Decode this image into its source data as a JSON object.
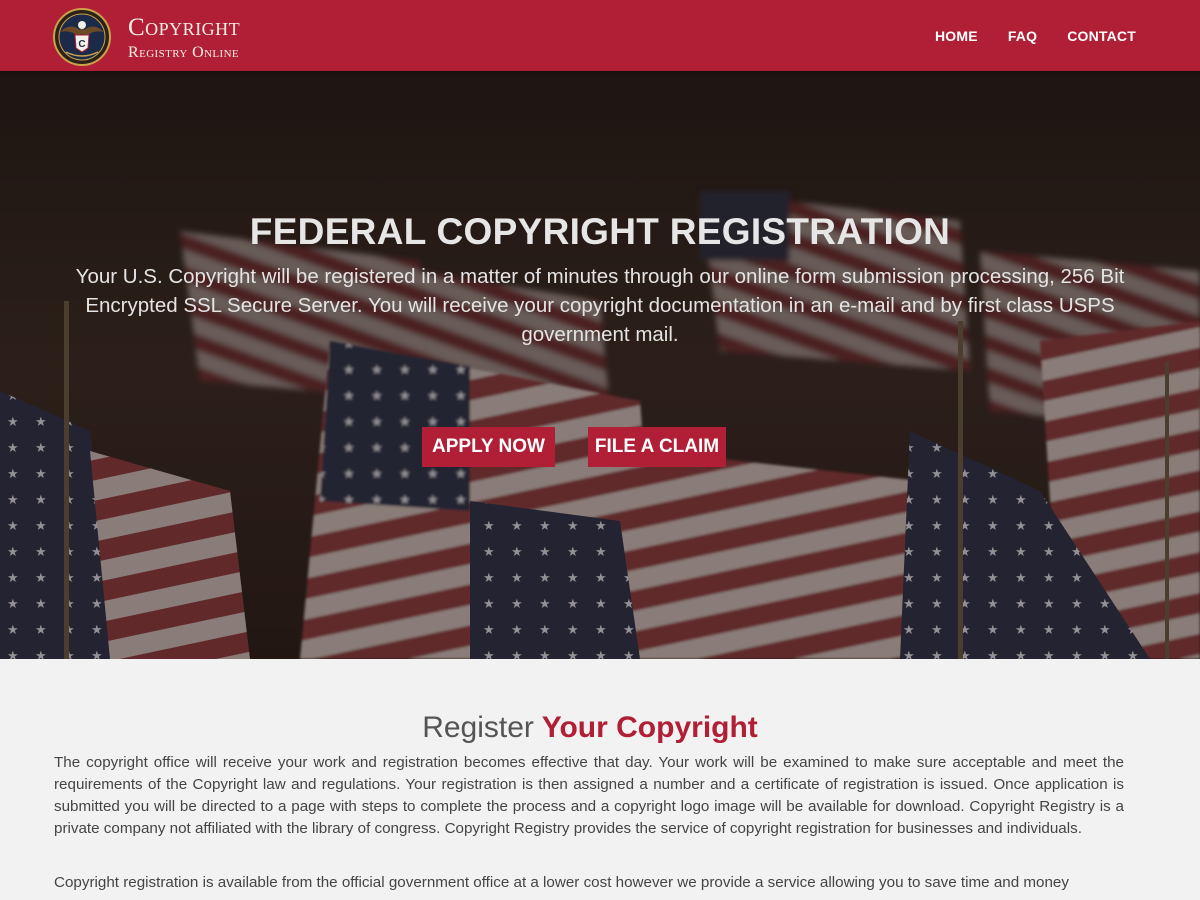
{
  "brand": {
    "line1": "Copyright",
    "line2": "Registry Online",
    "seal_icon": "eagle-seal-icon"
  },
  "nav": {
    "home": "HOME",
    "faq": "FAQ",
    "contact": "CONTACT"
  },
  "hero": {
    "title": "FEDERAL COPYRIGHT REGISTRATION",
    "text": "Your U.S. Copyright will be registered in a matter of minutes through our online form submission processing, 256 Bit Encrypted SSL Secure Server. You will receive your copyright documentation in an e-mail and by first class USPS government mail.",
    "apply_label": "APPLY NOW",
    "claim_label": "FILE A CLAIM"
  },
  "section": {
    "title_light": "Register",
    "title_bold": "Your Copyright",
    "paragraph1": "The copyright office will receive your work and registration becomes effective that day. Your work will be examined to make sure acceptable and meet the requirements of the Copyright law and regulations. Your registration is then assigned a number and a certificate of registration is issued. Once application is submitted you will be directed to a page with steps to complete the process and a copyright logo image will be available for download. Copyright Registry is a private company not affiliated with the library of congress. Copyright Registry provides the service of copyright registration for businesses and individuals.",
    "paragraph2": "Copyright registration is available from the official government office at a lower cost however we provide a service allowing you to save time and money"
  },
  "colors": {
    "brand_red": "#b01f35",
    "header_text": "#f7eee4",
    "background": "#f2f2f2"
  }
}
